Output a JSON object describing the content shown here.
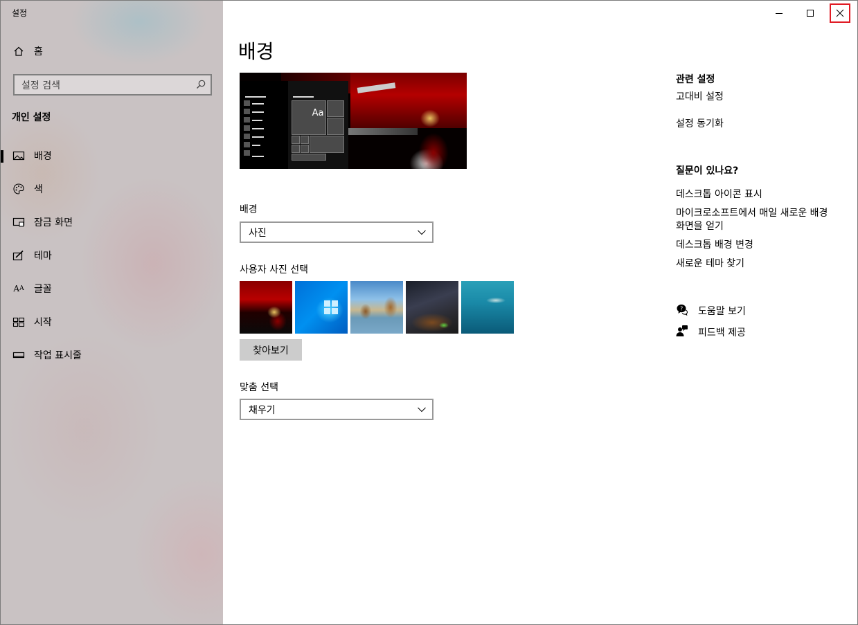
{
  "window": {
    "title": "설정"
  },
  "sidebar": {
    "home_label": "홈",
    "search_placeholder": "설정 검색",
    "section_title": "개인 설정",
    "items": [
      {
        "label": "배경",
        "icon": "image-icon",
        "active": true
      },
      {
        "label": "색",
        "icon": "palette-icon",
        "active": false
      },
      {
        "label": "잠금 화면",
        "icon": "lock-screen-icon",
        "active": false
      },
      {
        "label": "테마",
        "icon": "theme-brush-icon",
        "active": false
      },
      {
        "label": "글꼴",
        "icon": "font-icon",
        "active": false
      },
      {
        "label": "시작",
        "icon": "start-grid-icon",
        "active": false
      },
      {
        "label": "작업 표시줄",
        "icon": "taskbar-icon",
        "active": false
      }
    ]
  },
  "main": {
    "title": "배경",
    "preview_text": "Aa",
    "background_label": "배경",
    "background_value": "사진",
    "choose_photo_label": "사용자 사진 선택",
    "browse_label": "찾아보기",
    "fit_label": "맞춤 선택",
    "fit_value": "채우기"
  },
  "right": {
    "related_title": "관련 설정",
    "related_links": [
      "고대비 설정",
      "설정 동기화"
    ],
    "question_title": "질문이 있나요?",
    "question_links": [
      "데스크톱 아이콘 표시",
      "마이크로소프트에서 매일 새로운 배경",
      "화면을 얻기",
      "데스크톱 배경 변경",
      "새로운 테마 찾기"
    ],
    "help_label": "도움말 보기",
    "feedback_label": "피드백 제공"
  },
  "colors": {
    "accent": "#000000",
    "close_highlight": "#e01b24",
    "sidebar_bg": "#c9c2c3"
  }
}
